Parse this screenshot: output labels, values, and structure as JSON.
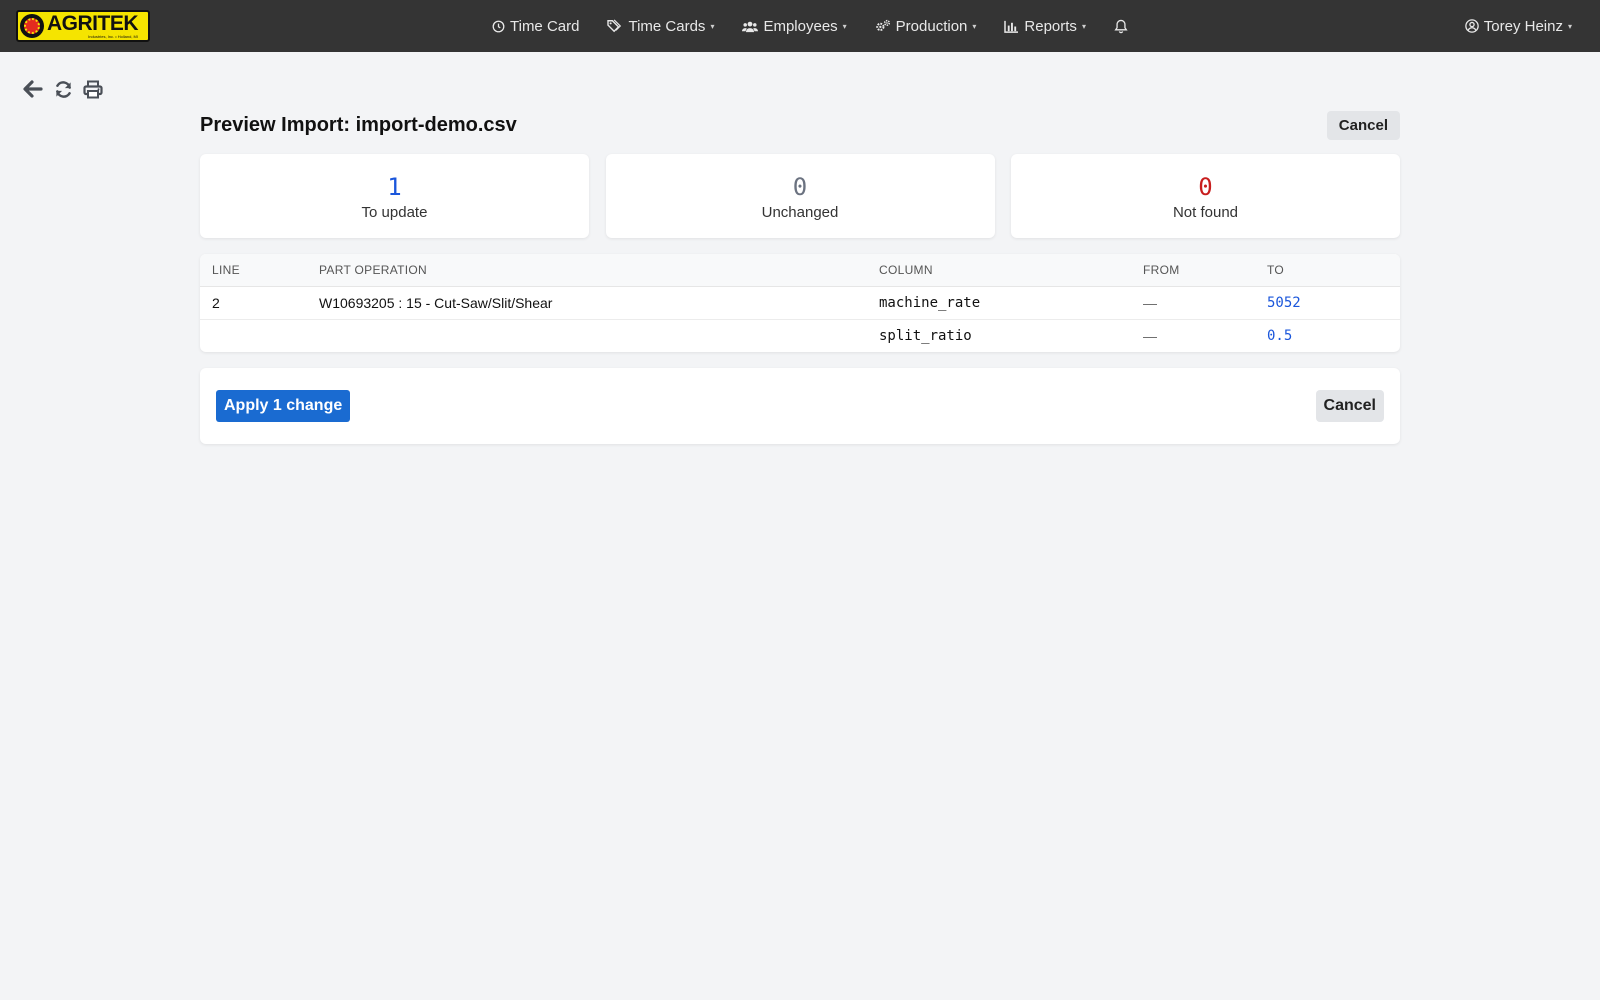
{
  "nav": {
    "logo_text": "AGRITEK",
    "logo_tagline": "Industries, Inc. • Holland, MI",
    "items": [
      {
        "label": "Time Card",
        "icon": "clock-icon",
        "caret": false
      },
      {
        "label": "Time Cards",
        "icon": "tags-icon",
        "caret": true
      },
      {
        "label": "Employees",
        "icon": "users-icon",
        "caret": true
      },
      {
        "label": "Production",
        "icon": "gears-icon",
        "caret": true
      },
      {
        "label": "Reports",
        "icon": "bar-chart-icon",
        "caret": true
      }
    ],
    "bell_icon": "bell-icon",
    "user_name": "Torey Heinz",
    "caret": "▾"
  },
  "toolbar": {
    "icons": [
      "back-arrow-icon",
      "refresh-icon",
      "print-icon"
    ]
  },
  "page": {
    "title": "Preview Import: import-demo.csv",
    "cancel_label": "Cancel"
  },
  "stats": [
    {
      "value": "1",
      "label": "To update",
      "color": "#1a56db"
    },
    {
      "value": "0",
      "label": "Unchanged",
      "color": "#6b7280"
    },
    {
      "value": "0",
      "label": "Not found",
      "color": "#c81e1e"
    }
  ],
  "table": {
    "headers": [
      "LINE",
      "PART OPERATION",
      "COLUMN",
      "FROM",
      "TO"
    ],
    "rows": [
      {
        "line": "2",
        "part_operation": "W10693205 : 15 - Cut-Saw/Slit/Shear",
        "column": "machine_rate",
        "from": "—",
        "to": "5052"
      },
      {
        "line": "",
        "part_operation": "",
        "column": "split_ratio",
        "from": "—",
        "to": "0.5"
      }
    ]
  },
  "actions": {
    "apply_label": "Apply 1 change",
    "cancel_label": "Cancel"
  },
  "colors": {
    "navbar": "#343434",
    "primary": "#1a6bd1",
    "accent_blue": "#1a56db",
    "danger": "#c81e1e",
    "logo_yellow": "#f5e400"
  }
}
